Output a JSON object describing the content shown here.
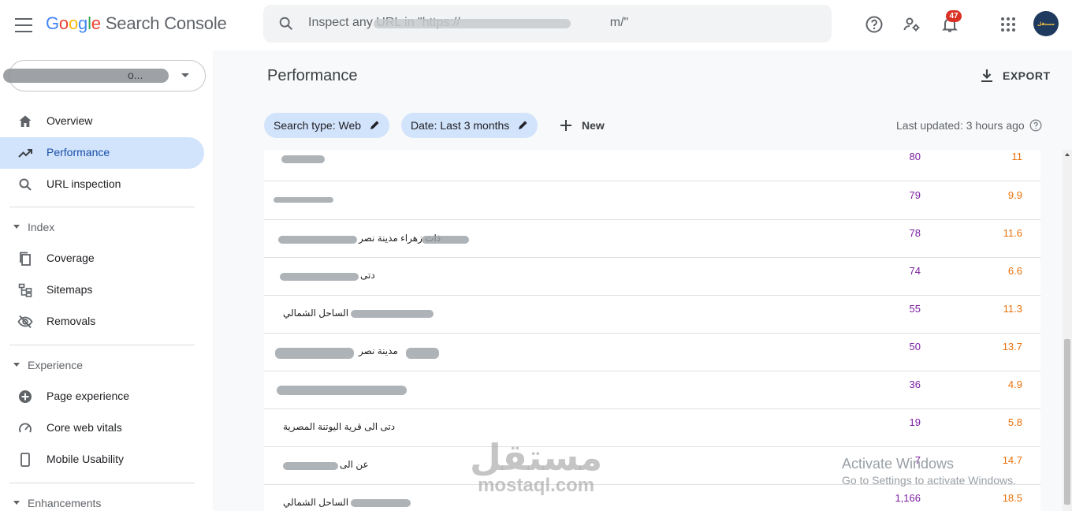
{
  "header": {
    "logo_google": [
      "G",
      "o",
      "o",
      "g",
      "l",
      "e"
    ],
    "logo_product": "Search Console",
    "search_placeholder": "Inspect any URL in \"https://",
    "search_tail": "m/\"",
    "notifications_count": "47",
    "avatar_text": "مستقل"
  },
  "sidebar": {
    "property_suffix": "o...",
    "items": [
      {
        "label": "Overview",
        "icon": "home-icon"
      },
      {
        "label": "Performance",
        "icon": "trending-up-icon"
      },
      {
        "label": "URL inspection",
        "icon": "search-icon"
      }
    ],
    "sections": [
      {
        "label": "Index",
        "items": [
          {
            "label": "Coverage",
            "icon": "coverage-icon"
          },
          {
            "label": "Sitemaps",
            "icon": "sitemap-icon"
          },
          {
            "label": "Removals",
            "icon": "visibility-off-icon"
          }
        ]
      },
      {
        "label": "Experience",
        "items": [
          {
            "label": "Page experience",
            "icon": "page-experience-icon"
          },
          {
            "label": "Core web vitals",
            "icon": "speed-icon"
          },
          {
            "label": "Mobile Usability",
            "icon": "smartphone-icon"
          }
        ]
      },
      {
        "label": "Enhancements",
        "items": []
      }
    ],
    "active": "Performance"
  },
  "main": {
    "title": "Performance",
    "export_label": "EXPORT",
    "filters": {
      "search_type": "Search type: Web",
      "date": "Date: Last 3 months",
      "new_label": "New"
    },
    "last_updated": "Last updated: 3 hours ago",
    "colors": {
      "clicks": "#7b1fa2",
      "position": "#e8710a"
    },
    "rows": [
      {
        "query": "",
        "clicks": "80",
        "position": "11"
      },
      {
        "query": "",
        "clicks": "79",
        "position": "9.9"
      },
      {
        "query": "ذات زهراء مدينة نصر",
        "clicks": "78",
        "position": "11.6"
      },
      {
        "query": "دتى",
        "clicks": "74",
        "position": "6.6"
      },
      {
        "query": "الساحل الشمالي",
        "clicks": "55",
        "position": "11.3"
      },
      {
        "query": "مدينة نصر",
        "clicks": "50",
        "position": "13.7"
      },
      {
        "query": "",
        "clicks": "36",
        "position": "4.9"
      },
      {
        "query": "دتى الى قرية اليوتنة المصرية",
        "clicks": "19",
        "position": "5.8"
      },
      {
        "query": "عن الى",
        "clicks": "7",
        "position": "14.7"
      },
      {
        "query": "الساحل الشمالي",
        "clicks": "1,166",
        "position": "18.5"
      }
    ]
  },
  "overlay": {
    "activate_title": "Activate Windows",
    "activate_sub": "Go to Settings to activate Windows.",
    "watermark_ar": "مستقل",
    "watermark_en": "mostaql.com"
  }
}
